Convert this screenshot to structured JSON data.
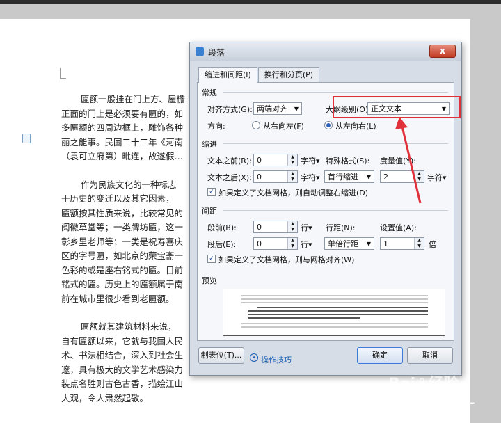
{
  "document": {
    "lines": [
      "匾额一般挂在门上方、屋檐",
      "正面的门上是必须要有匾的，如",
      "多匾额的四周边框上，雕饰各种",
      "丽之能事。民国二十二年《河南",
      "（袁可立府第）毗连，故遂假…",
      "",
      "作为民族文化的一种标志",
      "于历史的变迁以及其它因素，",
      "匾额按其性质来说，比较常见的",
      "阅徽草堂等；一类牌坊匾，这一",
      "彰乡里老师等；一类是祝寿喜庆",
      "区的字号匾，如北京的荣宝斋一",
      "色彩的或是座右铭式的匾。目前",
      "铭式的匾。历史上的匾额属于南",
      "前在城市里很少看到老匾额。",
      "",
      "匾额就其建筑材料来说，",
      "自有匾额以来，它就与我国人民",
      "术、书法相结合，深入到社会生",
      "邃，具有极大的文学艺术感染力",
      "装点名胜则古色古香，描绘江山",
      "大观，令人肃然起敬。"
    ]
  },
  "dialog": {
    "title": "段落",
    "close_label": "x",
    "tabs": [
      "缩进和间距(I)",
      "换行和分页(P)"
    ],
    "general": {
      "section": "常规",
      "align_label": "对齐方式(G):",
      "align_value": "两端对齐",
      "outline_label": "大纲级别(O):",
      "outline_value": "正文文本",
      "direction_label": "方向:",
      "rtl_label": "从右向左(F)",
      "ltr_label": "从左向右(L)"
    },
    "indent": {
      "section": "缩进",
      "before_label": "文本之前(R):",
      "before_value": "0",
      "before_unit": "字符▾",
      "after_label": "文本之后(X):",
      "after_value": "0",
      "after_unit": "字符▾",
      "special_label": "特殊格式(S):",
      "special_value": "首行缩进",
      "measure_label": "度量值(Y):",
      "measure_value": "2",
      "measure_unit": "字符▾",
      "auto_adjust_label": "如果定义了文档网格，则自动调整右缩进(D)"
    },
    "spacing": {
      "section": "间距",
      "before_label": "段前(B):",
      "before_value": "0",
      "before_unit": "行▾",
      "after_label": "段后(E):",
      "after_value": "0",
      "after_unit": "行▾",
      "line_label": "行距(N):",
      "line_value": "单倍行距",
      "set_label": "设置值(A):",
      "set_value": "1",
      "set_unit": "倍",
      "grid_label": "如果定义了文档网格，则与网格对齐(W)"
    },
    "preview": {
      "section": "预览"
    },
    "buttons": {
      "tabs_label": "制表位(T)...",
      "tips_label": "操作技巧",
      "ok_label": "确定",
      "cancel_label": "取消"
    }
  },
  "watermark": {
    "baidu": "Bai❀经验",
    "zhihu": "知乎 @非一"
  },
  "colors": {
    "highlight": "#e0303a",
    "arrow": "#e0303a"
  }
}
